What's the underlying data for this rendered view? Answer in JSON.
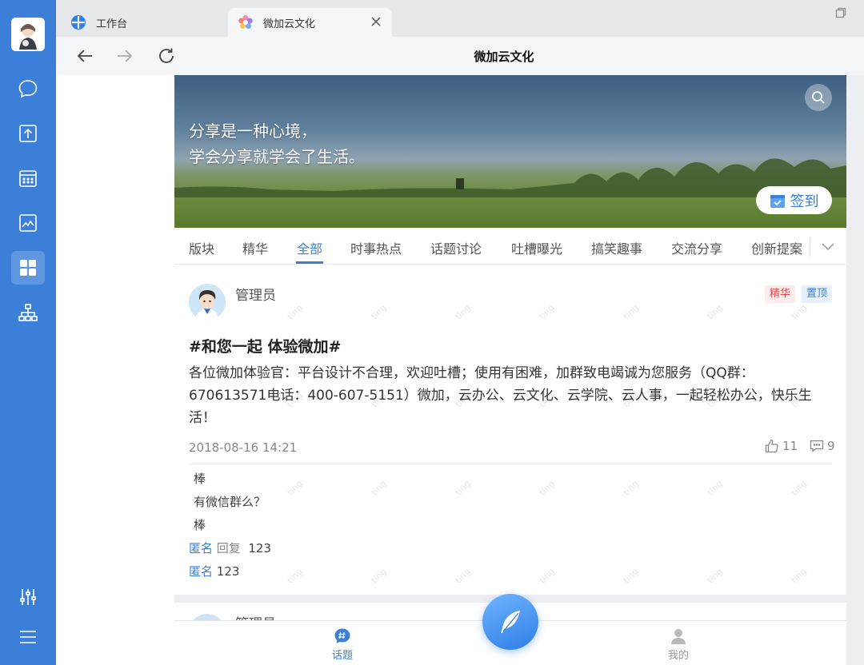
{
  "tabs": [
    {
      "label": "工作台"
    },
    {
      "label": "微加云文化"
    }
  ],
  "nav": {
    "title": "微加云文化"
  },
  "banner": {
    "slogan_line1": "分享是一种心境，",
    "slogan_line2": "学会分享就学会了生活。",
    "signin_label": "签到"
  },
  "categories": [
    "版块",
    "精华",
    "全部",
    "时事热点",
    "话题讨论",
    "吐槽曝光",
    "搞笑趣事",
    "交流分享",
    "创新提案"
  ],
  "active_category": "全部",
  "watermark_text": "ting",
  "post": {
    "author": "管理员",
    "badge_featured": "精华",
    "badge_pinned": "置顶",
    "title": "#和您一起 体验微加#",
    "body": "各位微加体验官：平台设计不合理，欢迎吐槽；使用有困难，加群致电竭诚为您服务（QQ群：670613571电话：400-607-5151）微加，云办公、云文化、云学院、云人事，一起轻松办公，快乐生活！",
    "date": "2018-08-16 14:21",
    "likes": "11",
    "comments_count": "9",
    "comments": [
      "棒",
      "有微信群么？",
      "棒"
    ],
    "replies": [
      {
        "name": "匿名",
        "action": "回复",
        "text": "123"
      },
      {
        "name": "匿名",
        "text": "123"
      }
    ]
  },
  "post2": {
    "author": "管理员"
  },
  "bottom_nav": {
    "topic": "话题",
    "mine": "我的"
  },
  "colors": {
    "rail": "#3b7fd9",
    "accent": "#3b82d6",
    "featured": "#e5484d"
  }
}
